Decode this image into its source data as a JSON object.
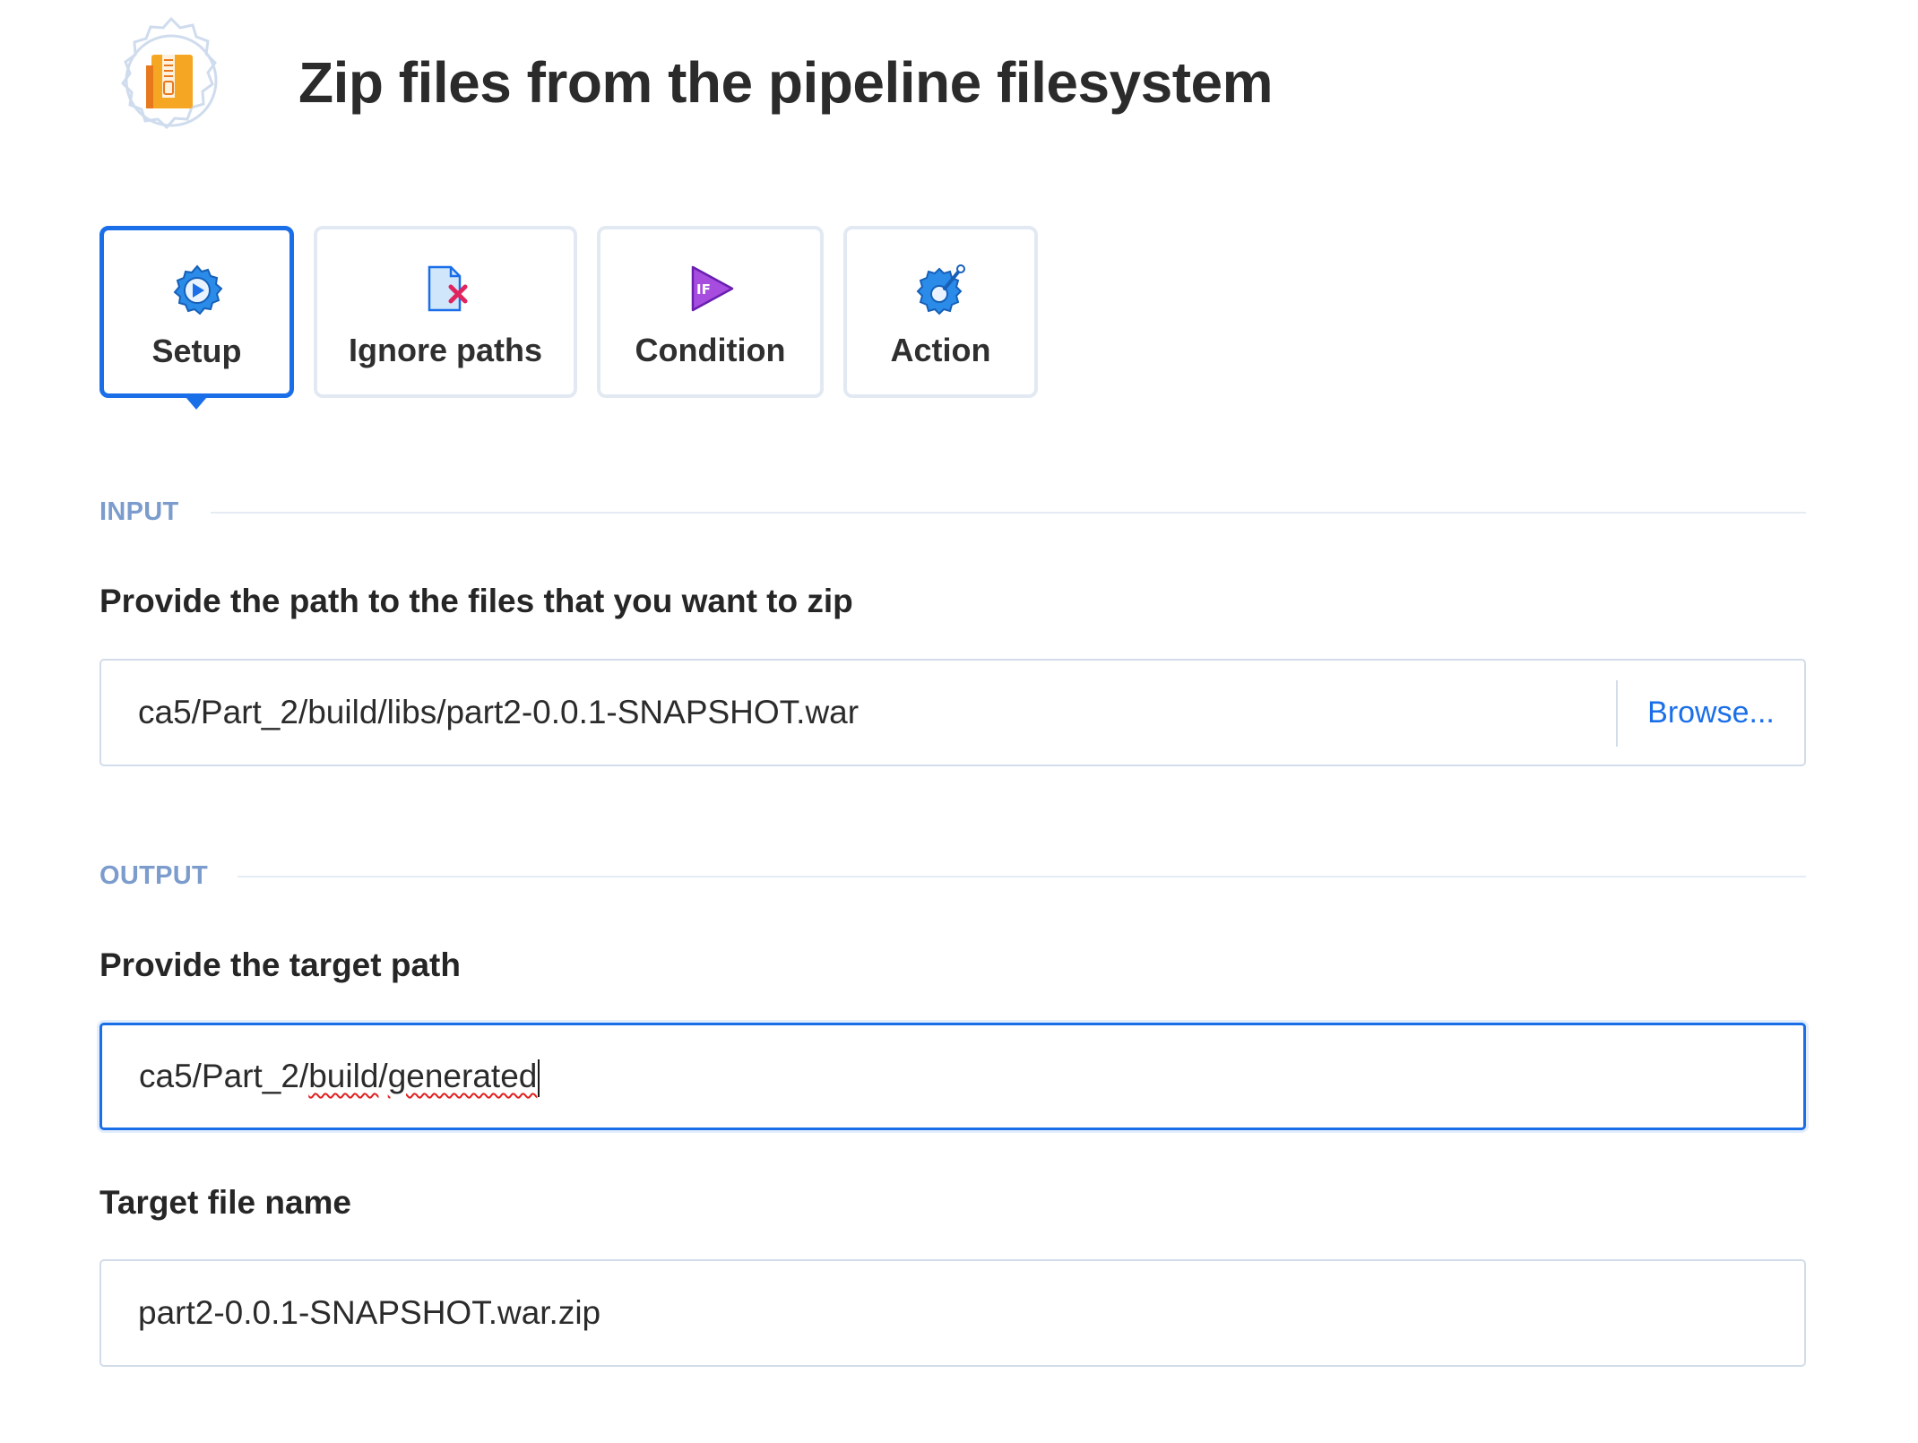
{
  "header": {
    "title": "Zip files from the pipeline filesystem",
    "icon": "zip-archive-icon"
  },
  "tabs": [
    {
      "label": "Setup",
      "icon": "setup-gear-play-icon",
      "active": true
    },
    {
      "label": "Ignore paths",
      "icon": "ignore-file-icon",
      "active": false
    },
    {
      "label": "Condition",
      "icon": "condition-if-icon",
      "active": false
    },
    {
      "label": "Action",
      "icon": "action-gear-icon",
      "active": false
    }
  ],
  "input_section": {
    "heading": "INPUT",
    "source_label": "Provide the path to the files that you want to zip",
    "source_value": "ca5/Part_2/build/libs/part2-0.0.1-SNAPSHOT.war",
    "browse_label": "Browse..."
  },
  "output_section": {
    "heading": "OUTPUT",
    "target_path_label": "Provide the target path",
    "target_path_prefix": "ca5/Part_2/",
    "target_path_word1": "build",
    "target_path_sep": "/",
    "target_path_word2": "generated",
    "target_name_label": "Target file name",
    "target_name_value": "part2-0.0.1-SNAPSHOT.war.zip"
  },
  "colors": {
    "accent": "#1a6fe8",
    "section_heading": "#7b9ccc",
    "border": "#d3dcea",
    "zip_orange": "#f5a623",
    "condition_purple": "#8b3fd1",
    "ignore_red": "#e0245e"
  }
}
